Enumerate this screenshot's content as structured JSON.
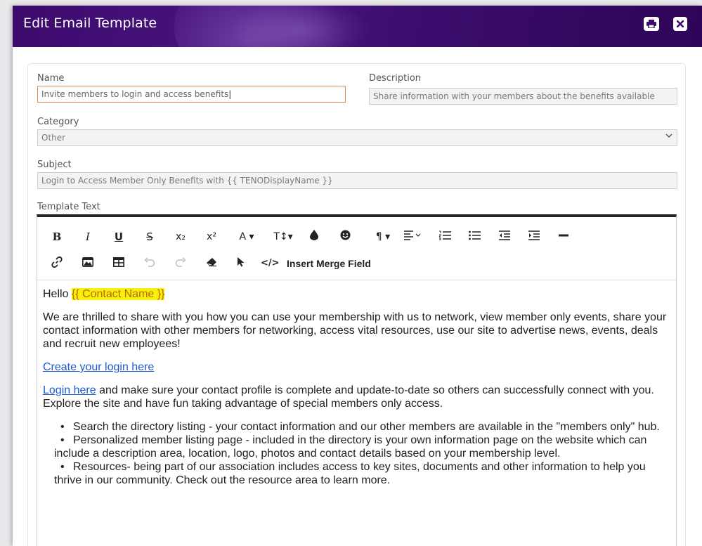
{
  "window": {
    "title": "Edit Email Template"
  },
  "form": {
    "name_label": "Name",
    "name_value": "Invite members to login and access benefits",
    "description_label": "Description",
    "description_value": "Share information with your members about the benefits available",
    "category_label": "Category",
    "category_value": "Other",
    "subject_label": "Subject",
    "subject_value": "Login to Access Member Only Benefits with {{ TENODisplayName }}",
    "template_text_label": "Template Text"
  },
  "toolbar": {
    "bold": "B",
    "italic": "I",
    "underline": "U",
    "strikethrough": "S",
    "subscript": "x₂",
    "superscript": "x²",
    "font_color": "A ▾",
    "font_size": "T↕▾",
    "insert_merge_field": "Insert Merge Field"
  },
  "body": {
    "greeting_prefix": "Hello ",
    "merge_contact_name": "{{ Contact Name }}",
    "para1": "We are thrilled to share with you how you can use your membership with us to network, view member only events, share your contact information with other members for networking, access vital resources, use our site to advertise news, events, deals and recruit new employees!",
    "create_login_link": "Create your login here",
    "login_link": "Login here",
    "para2_rest": " and make sure your contact profile is complete and update-to-date so others can successfully connect with you. Explore the site and have fun taking advantage of special members only access.",
    "bullets": [
      "Search the directory listing - your contact information and our other members are available in the \"members only\" hub.",
      "Personalized member listing page - included in the directory is your own information page on the website which can include a description area, location, logo, photos and contact details based on your membership level.",
      "Resources- being part of our association includes access to key sites, documents and other information to help you thrive in our community. Check out the resource area to learn more."
    ]
  },
  "colors": {
    "header_bg": "#3b0a6b",
    "active_border": "#e08a5a",
    "merge_highlight": "#f6f00a",
    "link": "#1a5ad6"
  }
}
